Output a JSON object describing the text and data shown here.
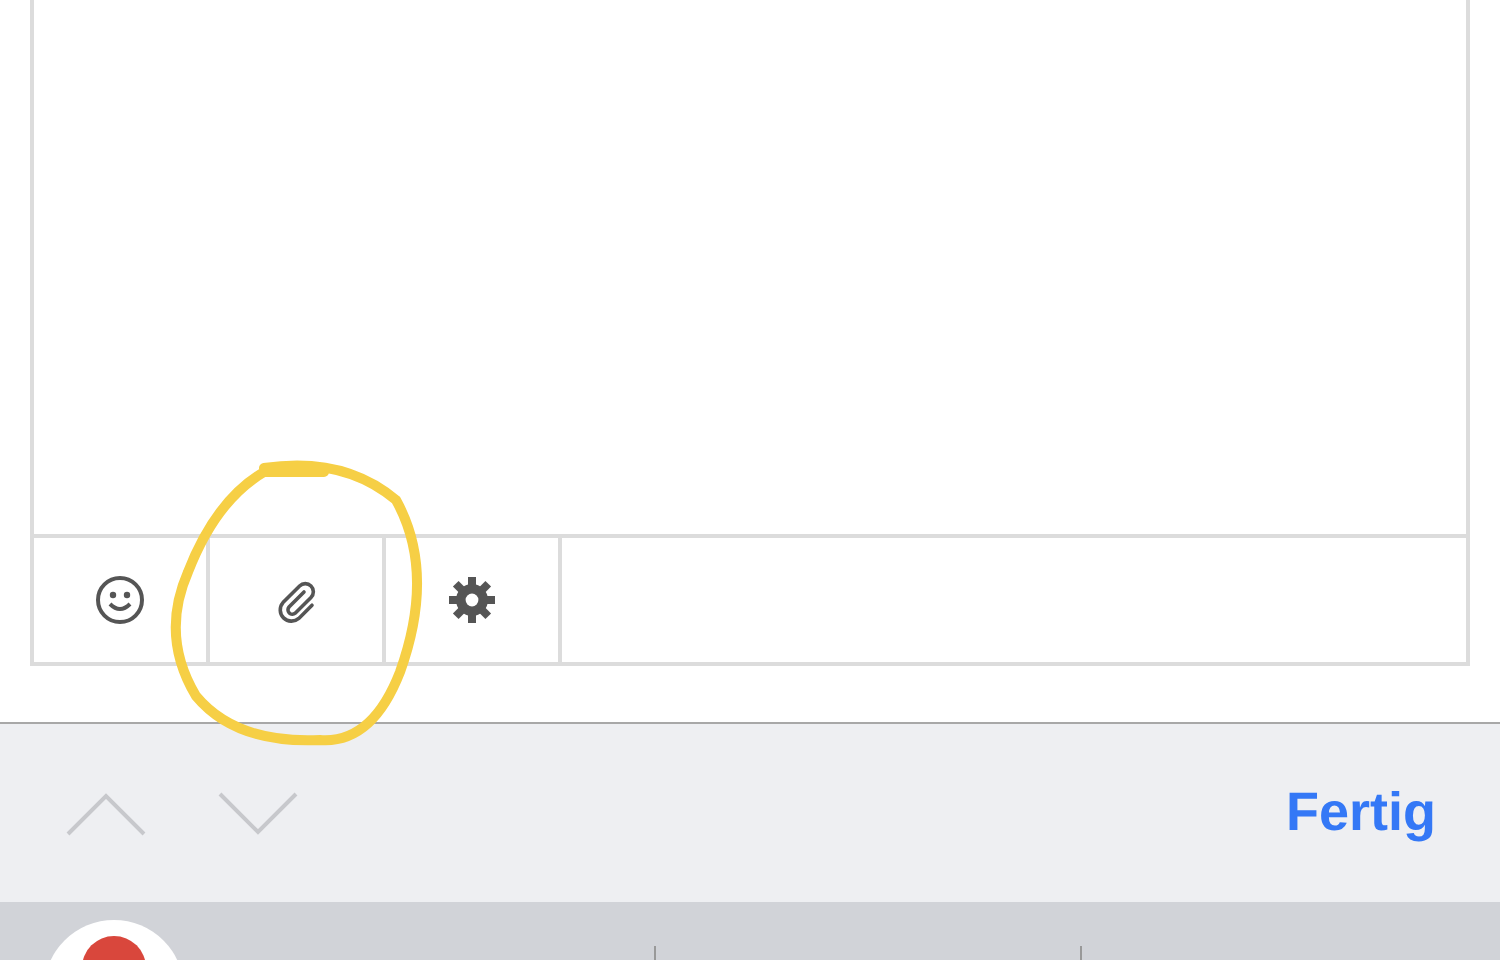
{
  "accessory_bar": {
    "done_label": "Fertig"
  }
}
